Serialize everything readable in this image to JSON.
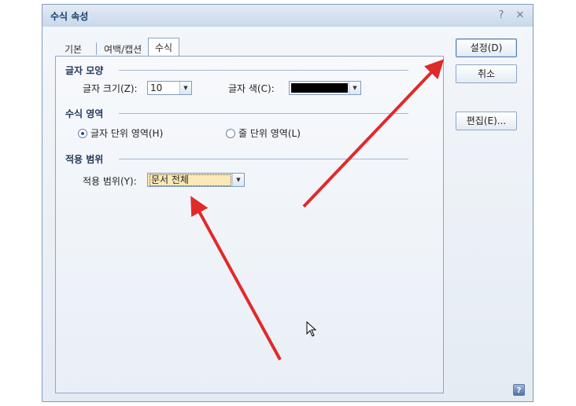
{
  "dialog": {
    "title": "수식 속성",
    "help_glyph": "?",
    "close_glyph": "✕"
  },
  "tabs": [
    {
      "label": "기본"
    },
    {
      "label": "여백/캡션"
    },
    {
      "label": "수식"
    }
  ],
  "font_shape": {
    "title": "글자 모양",
    "size_label": "글자 크기(Z):",
    "size_value": "10",
    "color_label": "글자 색(C):",
    "color_value": "#000000"
  },
  "equation_area": {
    "title": "수식 영역",
    "option_char": "글자 단위 영역(H)",
    "option_line": "줄 단위 영역(L)",
    "selected": "option_char"
  },
  "apply_range": {
    "title": "적용 범위",
    "label": "적용 범위(Y):",
    "value": "문서 전체"
  },
  "buttons": {
    "set": "설정(D)",
    "cancel": "취소",
    "edit": "편집(E)..."
  },
  "help_button_glyph": "?",
  "colors": {
    "annotation_arrow": "#e02a2a",
    "highlight_field": "#fde9b8"
  },
  "icons": {
    "help": "question-mark-icon",
    "close": "close-icon",
    "dropdown": "chevron-down-icon",
    "cursor": "mouse-pointer-icon"
  }
}
